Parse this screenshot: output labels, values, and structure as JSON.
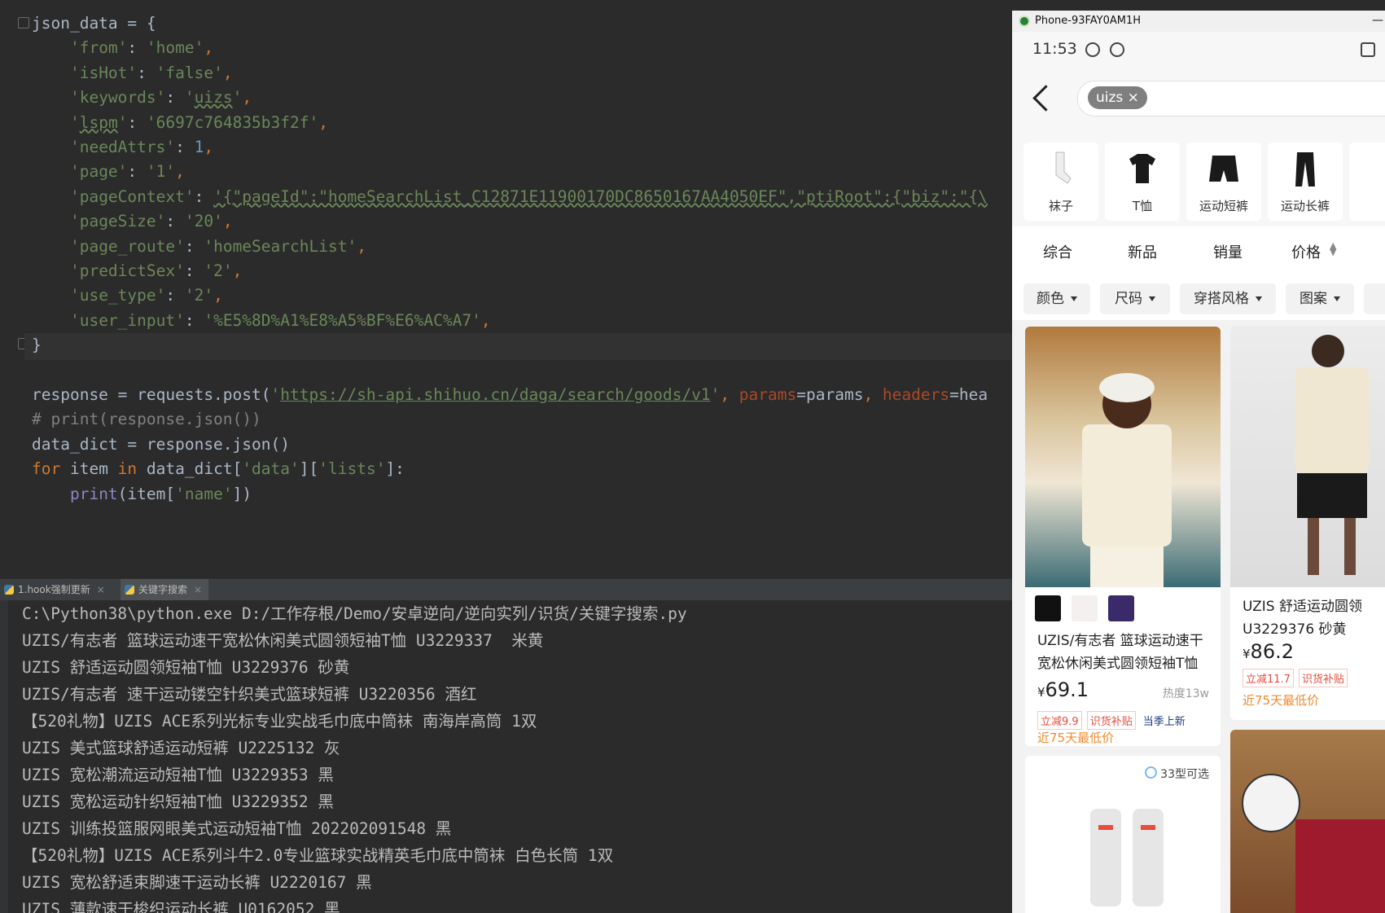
{
  "editor": {
    "lines": [
      {
        "parts": [
          [
            "t",
            "json_data = {"
          ]
        ]
      },
      {
        "parts": [
          [
            "t",
            "    "
          ],
          [
            "s",
            "'from'"
          ],
          [
            "t",
            ": "
          ],
          [
            "s",
            "'home'"
          ],
          [
            "k",
            ","
          ]
        ]
      },
      {
        "parts": [
          [
            "t",
            "    "
          ],
          [
            "s",
            "'isHot'"
          ],
          [
            "t",
            ": "
          ],
          [
            "s",
            "'false'"
          ],
          [
            "k",
            ","
          ]
        ]
      },
      {
        "parts": [
          [
            "t",
            "    "
          ],
          [
            "s",
            "'keywords'"
          ],
          [
            "t",
            ": "
          ],
          [
            "s",
            "'"
          ],
          [
            "sw",
            "uizs"
          ],
          [
            "s",
            "'"
          ],
          [
            "k",
            ","
          ]
        ]
      },
      {
        "parts": [
          [
            "t",
            "    "
          ],
          [
            "s",
            "'"
          ],
          [
            "sw",
            "lspm"
          ],
          [
            "s",
            "'"
          ],
          [
            "t",
            ": "
          ],
          [
            "s",
            "'6697c764835b3f2f'"
          ],
          [
            "k",
            ","
          ]
        ]
      },
      {
        "parts": [
          [
            "t",
            "    "
          ],
          [
            "s",
            "'needAttrs'"
          ],
          [
            "t",
            ": "
          ],
          [
            "n",
            "1"
          ],
          [
            "k",
            ","
          ]
        ]
      },
      {
        "parts": [
          [
            "t",
            "    "
          ],
          [
            "s",
            "'page'"
          ],
          [
            "t",
            ": "
          ],
          [
            "s",
            "'1'"
          ],
          [
            "k",
            ","
          ]
        ]
      },
      {
        "parts": [
          [
            "t",
            "    "
          ],
          [
            "s",
            "'pageContext'"
          ],
          [
            "t",
            ": "
          ],
          [
            "sw",
            "'{\"pageId\":\"homeSearchList_C12871E11900170DC8650167AA4050EF\",\"ptiRoot\":{\"biz\":\"{\\"
          ]
        ]
      },
      {
        "parts": [
          [
            "t",
            "    "
          ],
          [
            "s",
            "'pageSize'"
          ],
          [
            "t",
            ": "
          ],
          [
            "s",
            "'20'"
          ],
          [
            "k",
            ","
          ]
        ]
      },
      {
        "parts": [
          [
            "t",
            "    "
          ],
          [
            "s",
            "'page_route'"
          ],
          [
            "t",
            ": "
          ],
          [
            "s",
            "'homeSearchList'"
          ],
          [
            "k",
            ","
          ]
        ]
      },
      {
        "parts": [
          [
            "t",
            "    "
          ],
          [
            "s",
            "'predictSex'"
          ],
          [
            "t",
            ": "
          ],
          [
            "s",
            "'2'"
          ],
          [
            "k",
            ","
          ]
        ]
      },
      {
        "parts": [
          [
            "t",
            "    "
          ],
          [
            "s",
            "'use_type'"
          ],
          [
            "t",
            ": "
          ],
          [
            "s",
            "'2'"
          ],
          [
            "k",
            ","
          ]
        ]
      },
      {
        "parts": [
          [
            "t",
            "    "
          ],
          [
            "s",
            "'user_input'"
          ],
          [
            "t",
            ": "
          ],
          [
            "s",
            "'%E5%8D%A1%E8%A5%BF%E6%AC%A7'"
          ],
          [
            "k",
            ","
          ]
        ]
      },
      {
        "parts": [
          [
            "t",
            "}"
          ]
        ]
      },
      {
        "parts": []
      },
      {
        "parts": [
          [
            "t",
            "response = requests.post("
          ],
          [
            "s",
            "'"
          ],
          [
            "su",
            "https://sh-api.shihuo.cn/daga/search/goods/v1"
          ],
          [
            "s",
            "'"
          ],
          [
            "k",
            ", "
          ],
          [
            "p",
            "params"
          ],
          [
            "t",
            "=params"
          ],
          [
            "k",
            ", "
          ],
          [
            "p",
            "headers"
          ],
          [
            "t",
            "=hea"
          ]
        ]
      },
      {
        "parts": [
          [
            "c",
            "# print(response.json())"
          ]
        ]
      },
      {
        "parts": [
          [
            "t",
            "data_dict = response.json()"
          ]
        ]
      },
      {
        "parts": [
          [
            "k",
            "for "
          ],
          [
            "t",
            "item "
          ],
          [
            "k",
            "in "
          ],
          [
            "t",
            "data_dict["
          ],
          [
            "s",
            "'data'"
          ],
          [
            "t",
            "]["
          ],
          [
            "s",
            "'lists'"
          ],
          [
            "t",
            "]:"
          ]
        ]
      },
      {
        "parts": [
          [
            "t",
            "    "
          ],
          [
            "b",
            "print"
          ],
          [
            "t",
            "(item["
          ],
          [
            "s",
            "'name'"
          ],
          [
            "t",
            "])"
          ]
        ]
      }
    ]
  },
  "console": {
    "tabs": [
      {
        "label": "1.hook强制更新"
      },
      {
        "label": "关键字搜索"
      }
    ],
    "lines": [
      "C:\\Python38\\python.exe D:/工作存根/Demo/安卓逆向/逆向实列/识货/关键字搜索.py",
      "UZIS/有志者 篮球运动速干宽松休闲美式圆领短袖T恤 U3229337  米黄",
      "UZIS 舒适运动圆领短袖T恤 U3229376 砂黄",
      "UZIS/有志者 速干运动镂空针织美式篮球短裤 U3220356 酒红",
      "【520礼物】UZIS ACE系列光标专业实战毛巾底中筒袜 南海岸高筒 1双",
      "UZIS 美式篮球舒适运动短裤 U2225132 灰",
      "UZIS 宽松潮流运动短袖T恤 U3229353 黑",
      "UZIS 宽松运动针织短袖T恤 U3229352 黑",
      "UZIS 训练投篮服网眼美式运动短袖T恤 202202091548 黑",
      "【520礼物】UZIS ACE系列斗牛2.0专业篮球实战精英毛巾底中筒袜 白色长筒 1双",
      "UZIS 宽松舒适束脚速干运动长裤 U2220167 黑",
      "UZIS 薄款速干梭织运动长裤 U0162052 黑"
    ]
  },
  "phone": {
    "window_title": "Phone-93FAY0AM1H",
    "time": "11:53",
    "search_chip": "uizs ×",
    "categories": [
      "袜子",
      "T恤",
      "运动短裤",
      "运动长裤"
    ],
    "sorts": [
      "综合",
      "新品",
      "销量",
      "价格"
    ],
    "filters": [
      "颜色",
      "尺码",
      "穿搭风格",
      "图案"
    ],
    "card1": {
      "title_line1": "UZIS/有志者 篮球运动速干",
      "title_line2": "宽松休闲美式圆领短袖T恤",
      "currency": "¥",
      "price": "69.1",
      "heat": "热度13w",
      "tag1": "立减9.9",
      "tag2": "识货补贴",
      "tag3": "当季上新",
      "lowest": "近75天最低价"
    },
    "card2": {
      "title_line1": "UZIS 舒适运动圆领",
      "title_line2": "U3229376 砂黄",
      "currency": "¥",
      "price": "86.2",
      "tag1": "立减11.7",
      "tag2": "识货补贴",
      "lowest": "近75天最低价"
    },
    "card3": {
      "badge": "33型可选"
    }
  }
}
